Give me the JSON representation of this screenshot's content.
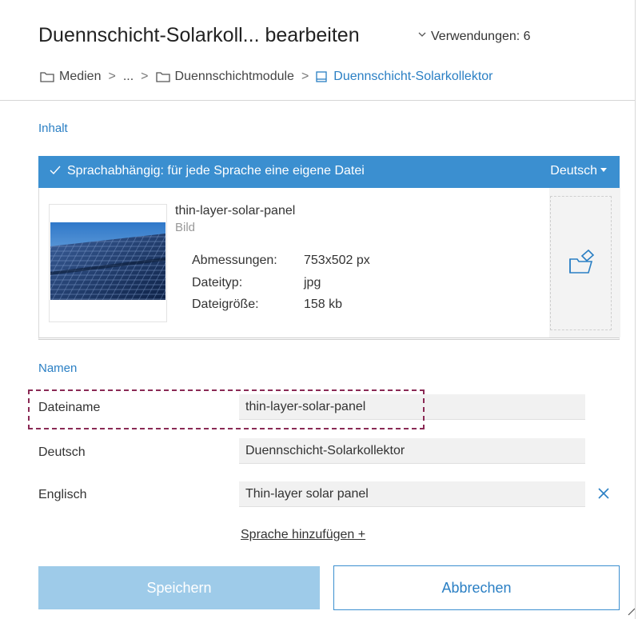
{
  "header": {
    "title": "Duennschicht-Solarkoll... bearbeiten",
    "usages": "Verwendungen: 6",
    "breadcrumb": [
      {
        "label": "Medien"
      },
      {
        "label": "..."
      },
      {
        "label": "Duennschichtmodule"
      },
      {
        "label": "Duennschicht-Solarkollektor"
      }
    ]
  },
  "content": {
    "section_label": "Inhalt",
    "language_bar": {
      "text": "Sprachabhängig: für jede Sprache eine eigene Datei",
      "selected_language": "Deutsch"
    },
    "file": {
      "name": "thin-layer-solar-panel",
      "kind": "Bild",
      "meta": [
        {
          "label": "Abmessungen:",
          "value": "753x502 px"
        },
        {
          "label": "Dateityp:",
          "value": "jpg"
        },
        {
          "label": "Dateigröße:",
          "value": "158 kb"
        }
      ]
    }
  },
  "names": {
    "section_label": "Namen",
    "rows": [
      {
        "label": "Dateiname",
        "value": "thin-layer-solar-panel"
      },
      {
        "label": "Deutsch",
        "value": "Duennschicht-Solarkollektor"
      },
      {
        "label": "Englisch",
        "value": "Thin-layer solar panel"
      }
    ],
    "add_language": "Sprache hinzufügen +"
  },
  "actions": {
    "save": "Speichern",
    "cancel": "Abbrechen"
  },
  "colors": {
    "accent": "#3b8fd0",
    "link": "#2a7fc4",
    "save_disabled": "#9ecbe9",
    "highlight": "#8a2a55"
  }
}
